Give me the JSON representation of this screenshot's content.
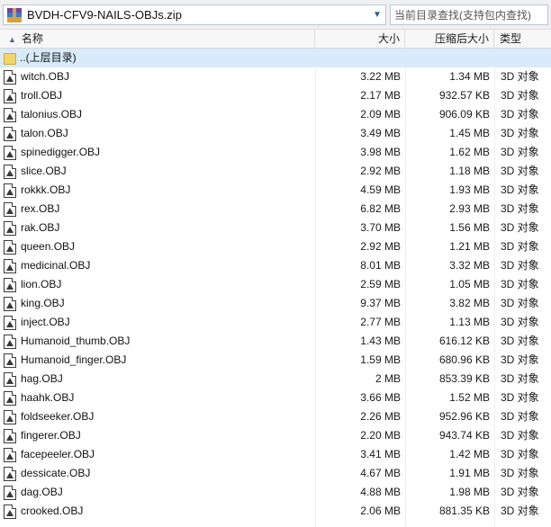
{
  "topbar": {
    "archive_name": "BVDH-CFV9-NAILS-OBJs.zip",
    "search_placeholder": "当前目录查找(支持包内查找)",
    "archive_icon": "archive-zip-icon",
    "dropdown_icon": "chevron-down-icon"
  },
  "columns": {
    "name": "名称",
    "size": "大小",
    "packed": "压缩后大小",
    "type": "类型",
    "sort_icon": "sort-up-arrow-icon"
  },
  "parent_row": {
    "label": "..(上层目录)",
    "icon": "folder-icon"
  },
  "files": [
    {
      "name": "witch.OBJ",
      "size": "3.22 MB",
      "packed": "1.34 MB",
      "type": "3D 对象"
    },
    {
      "name": "troll.OBJ",
      "size": "2.17 MB",
      "packed": "932.57 KB",
      "type": "3D 对象"
    },
    {
      "name": "talonius.OBJ",
      "size": "2.09 MB",
      "packed": "906.09 KB",
      "type": "3D 对象"
    },
    {
      "name": "talon.OBJ",
      "size": "3.49 MB",
      "packed": "1.45 MB",
      "type": "3D 对象"
    },
    {
      "name": "spinedigger.OBJ",
      "size": "3.98 MB",
      "packed": "1.62 MB",
      "type": "3D 对象"
    },
    {
      "name": "slice.OBJ",
      "size": "2.92 MB",
      "packed": "1.18 MB",
      "type": "3D 对象"
    },
    {
      "name": "rokkk.OBJ",
      "size": "4.59 MB",
      "packed": "1.93 MB",
      "type": "3D 对象"
    },
    {
      "name": "rex.OBJ",
      "size": "6.82 MB",
      "packed": "2.93 MB",
      "type": "3D 对象"
    },
    {
      "name": "rak.OBJ",
      "size": "3.70 MB",
      "packed": "1.56 MB",
      "type": "3D 对象"
    },
    {
      "name": "queen.OBJ",
      "size": "2.92 MB",
      "packed": "1.21 MB",
      "type": "3D 对象"
    },
    {
      "name": "medicinal.OBJ",
      "size": "8.01 MB",
      "packed": "3.32 MB",
      "type": "3D 对象"
    },
    {
      "name": "lion.OBJ",
      "size": "2.59 MB",
      "packed": "1.05 MB",
      "type": "3D 对象"
    },
    {
      "name": "king.OBJ",
      "size": "9.37 MB",
      "packed": "3.82 MB",
      "type": "3D 对象"
    },
    {
      "name": "inject.OBJ",
      "size": "2.77 MB",
      "packed": "1.13 MB",
      "type": "3D 对象"
    },
    {
      "name": "Humanoid_thumb.OBJ",
      "size": "1.43 MB",
      "packed": "616.12 KB",
      "type": "3D 对象"
    },
    {
      "name": "Humanoid_finger.OBJ",
      "size": "1.59 MB",
      "packed": "680.96 KB",
      "type": "3D 对象"
    },
    {
      "name": "hag.OBJ",
      "size": "2 MB",
      "packed": "853.39 KB",
      "type": "3D 对象"
    },
    {
      "name": "haahk.OBJ",
      "size": "3.66 MB",
      "packed": "1.52 MB",
      "type": "3D 对象"
    },
    {
      "name": "foldseeker.OBJ",
      "size": "2.26 MB",
      "packed": "952.96 KB",
      "type": "3D 对象"
    },
    {
      "name": "fingerer.OBJ",
      "size": "2.20 MB",
      "packed": "943.74 KB",
      "type": "3D 对象"
    },
    {
      "name": "facepeeler.OBJ",
      "size": "3.41 MB",
      "packed": "1.42 MB",
      "type": "3D 对象"
    },
    {
      "name": "dessicate.OBJ",
      "size": "4.67 MB",
      "packed": "1.91 MB",
      "type": "3D 对象"
    },
    {
      "name": "dag.OBJ",
      "size": "4.88 MB",
      "packed": "1.98 MB",
      "type": "3D 对象"
    },
    {
      "name": "crooked.OBJ",
      "size": "2.06 MB",
      "packed": "881.35 KB",
      "type": "3D 对象"
    }
  ],
  "file_icon": "3d-object-file-icon"
}
